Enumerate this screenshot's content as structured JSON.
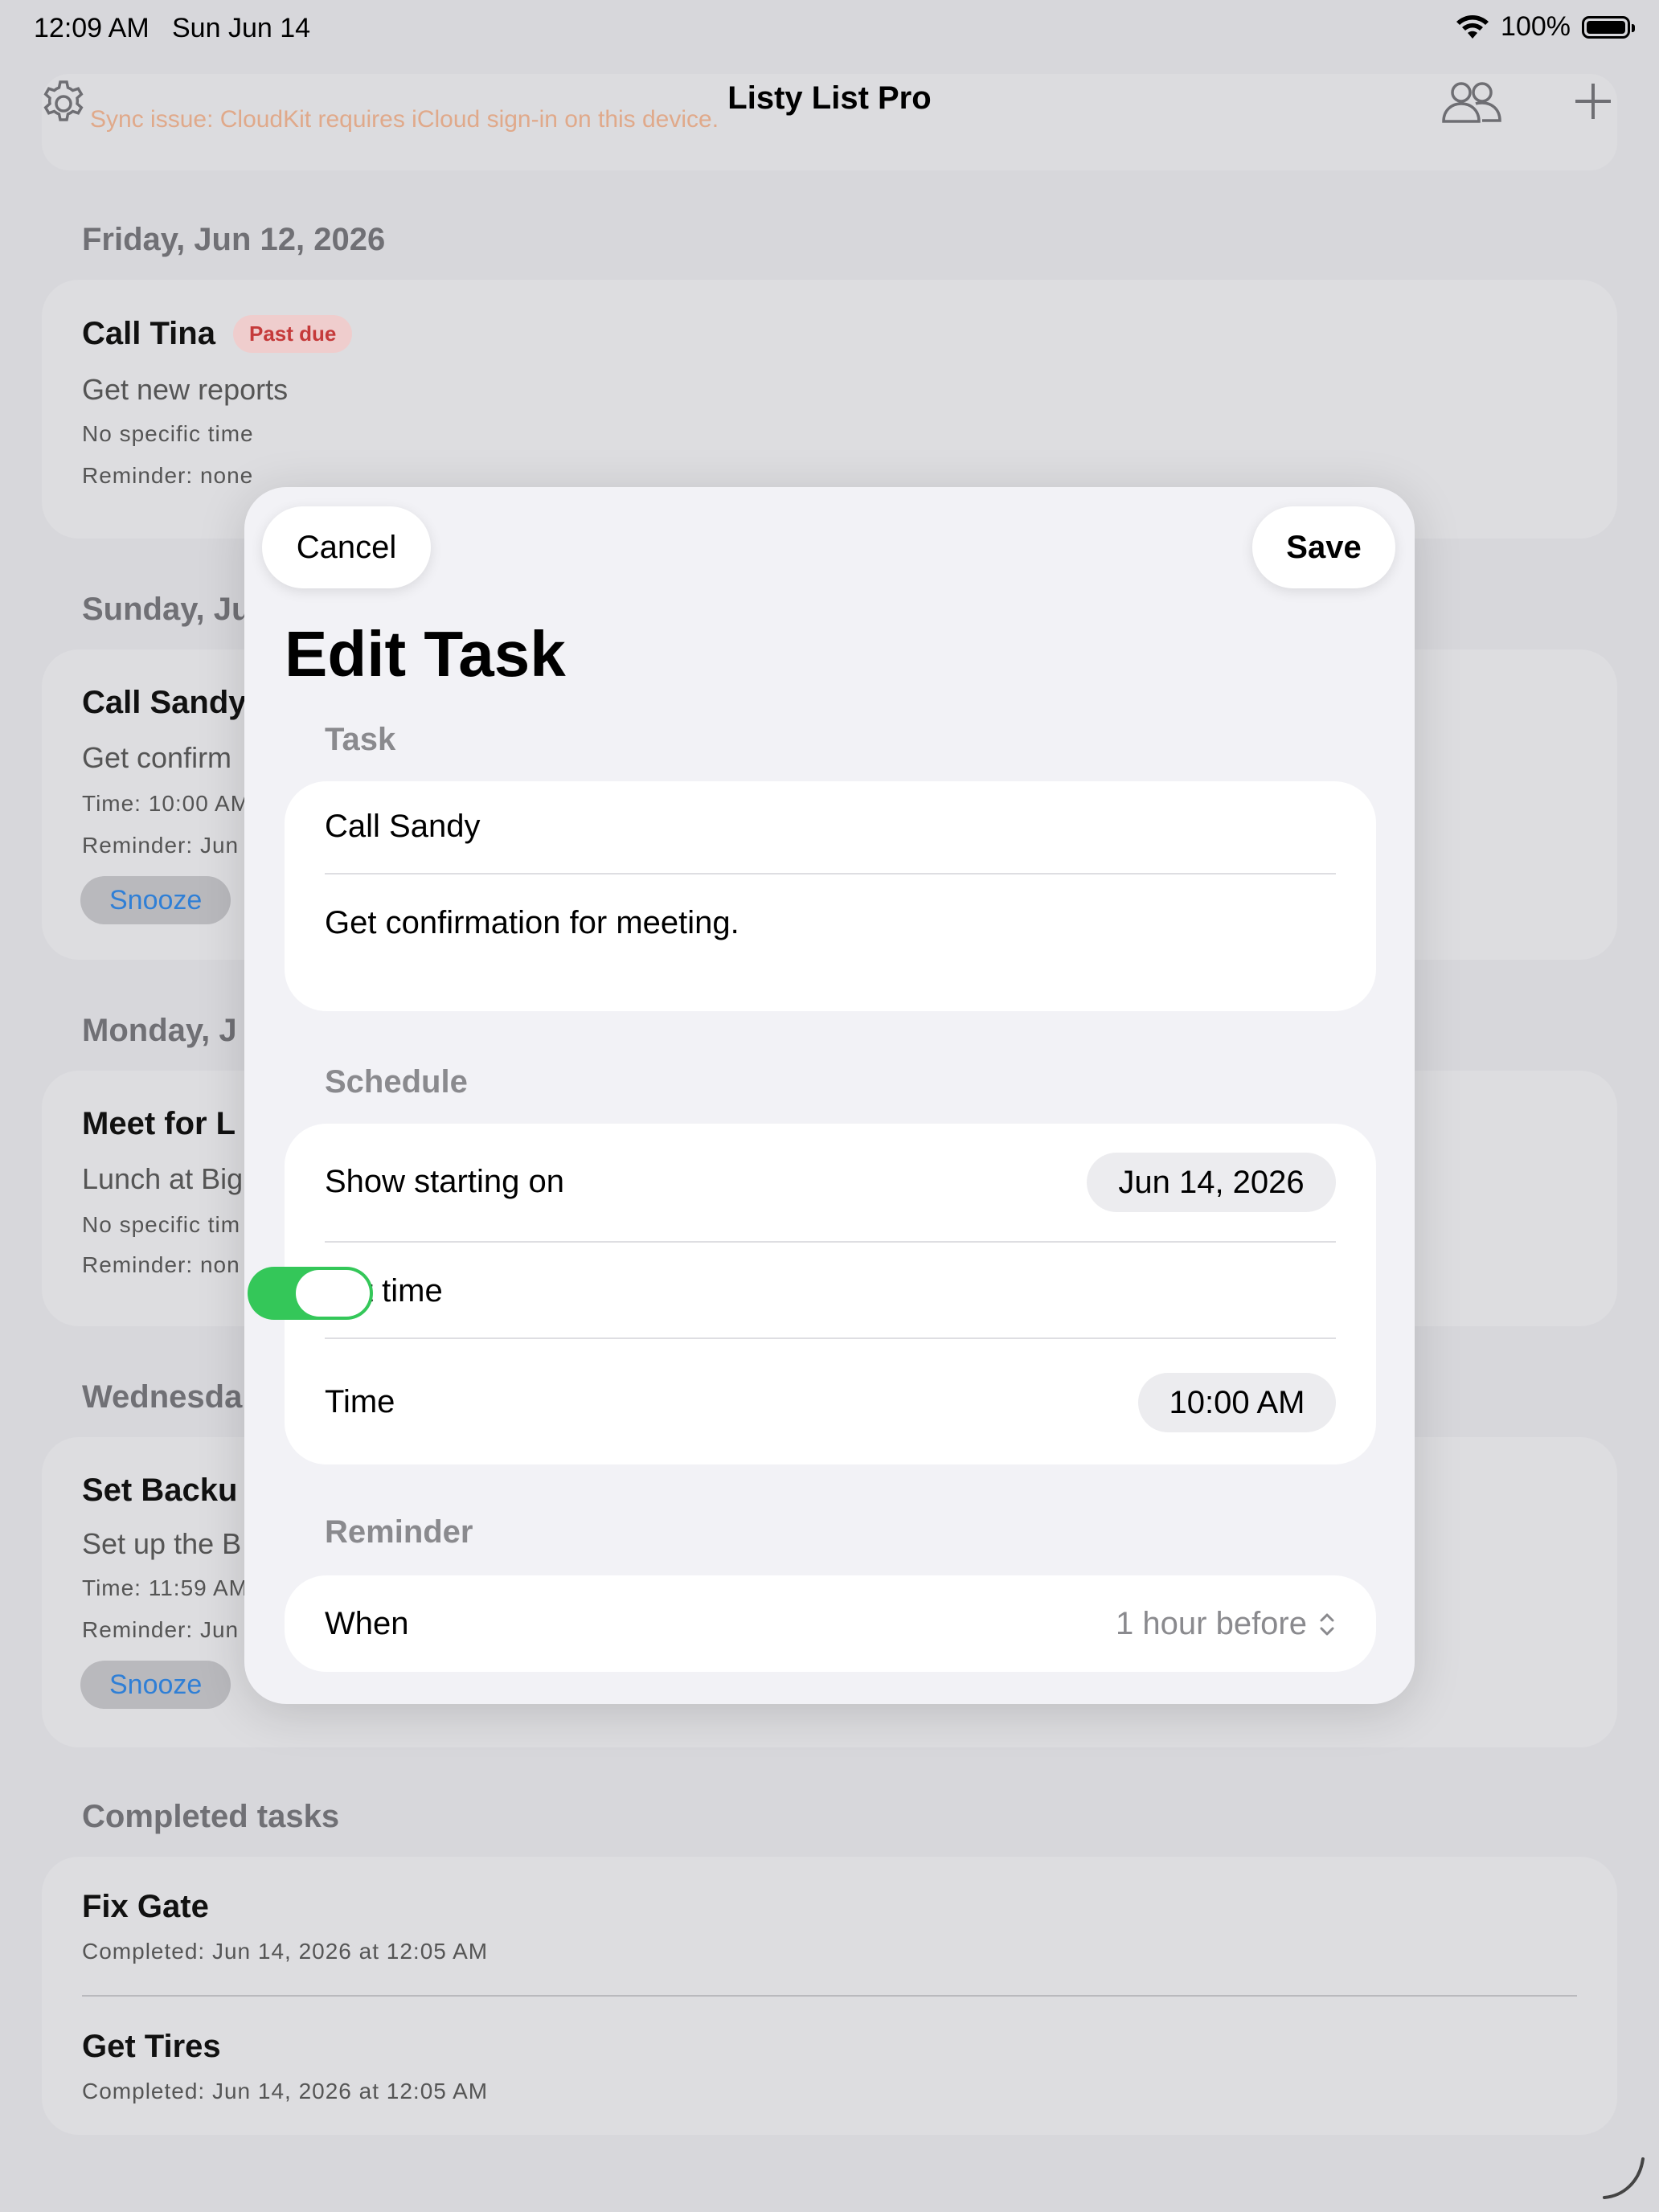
{
  "status_bar": {
    "time": "12:09 AM",
    "date": "Sun Jun 14",
    "battery": "100%"
  },
  "nav": {
    "title": "Listy List Pro",
    "settings_icon": "gear-icon",
    "people_icon": "people-icon",
    "add_icon": "plus-icon"
  },
  "sync_banner": {
    "text": "Sync issue: CloudKit requires iCloud sign-in on this device."
  },
  "sections": {
    "friday": {
      "header": "Friday, Jun 12, 2026",
      "task": {
        "title": "Call Tina",
        "badge": "Past due",
        "note": "Get new reports",
        "time": "No specific time",
        "reminder": "Reminder: none"
      }
    },
    "sunday": {
      "header": "Sunday, Ju",
      "task": {
        "title": "Call Sandy",
        "note": "Get confirm",
        "time": "Time: 10:00 AM",
        "reminder": "Reminder: Jun",
        "snooze": "Snooze"
      }
    },
    "monday": {
      "header": "Monday, J",
      "task": {
        "title": "Meet for L",
        "note": "Lunch at Big",
        "time": "No specific tim",
        "reminder": "Reminder: non"
      }
    },
    "wednesday": {
      "header": "Wednesda",
      "task": {
        "title": "Set Backu",
        "note": "Set up the B",
        "time": "Time: 11:59 AM",
        "reminder": "Reminder: Jun",
        "snooze": "Snooze"
      }
    },
    "completed": {
      "header": "Completed tasks",
      "items": [
        {
          "title": "Fix Gate",
          "completed": "Completed: Jun 14, 2026 at 12:05 AM"
        },
        {
          "title": "Get Tires",
          "completed": "Completed: Jun 14, 2026 at 12:05 AM"
        }
      ]
    }
  },
  "modal": {
    "cancel": "Cancel",
    "save": "Save",
    "title": "Edit Task",
    "task_label": "Task",
    "task_title_value": "Call Sandy",
    "task_note_value": "Get confirmation for meeting.",
    "schedule_label": "Schedule",
    "show_starting_label": "Show starting on",
    "show_starting_value": "Jun 14, 2026",
    "set_time_label": "Set time",
    "set_time_on": true,
    "time_label": "Time",
    "time_value": "10:00 AM",
    "reminder_label": "Reminder",
    "when_label": "When",
    "when_value": "1 hour before"
  },
  "colors": {
    "accent_green": "#34c759",
    "link_blue": "#2f7fd6",
    "past_due_red": "#c53a3a"
  }
}
